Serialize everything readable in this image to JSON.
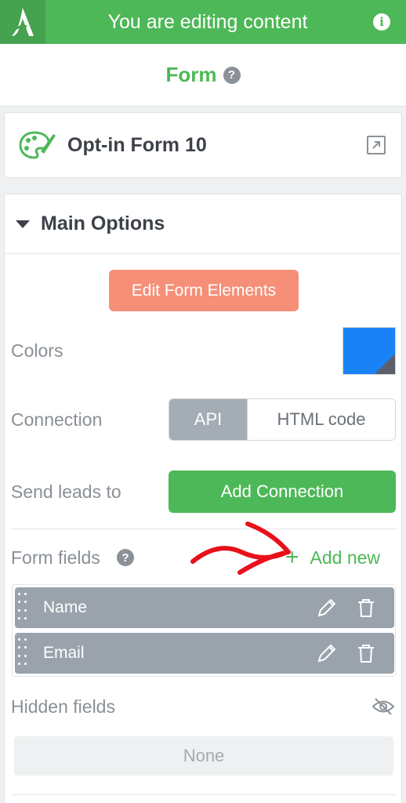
{
  "topbar": {
    "title": "You are editing content",
    "logo_icon": "thrive-logo-icon",
    "info_icon": "info-icon",
    "color": "#4db857"
  },
  "header": {
    "title": "Form",
    "help_icon": "help-icon"
  },
  "form_card": {
    "name": "Opt-in Form 10",
    "icon": "palette-icon",
    "open_icon": "external-link-icon"
  },
  "main_options": {
    "title": "Main Options",
    "edit_button": "Edit Form Elements",
    "colors_label": "Colors",
    "color_value": "#1a82f7",
    "connection_label": "Connection",
    "connection_options": [
      "API",
      "HTML code"
    ],
    "connection_selected": "API",
    "send_leads_label": "Send leads to",
    "add_connection_button": "Add Connection",
    "form_fields_label": "Form fields",
    "add_new_label": "Add new",
    "fields": [
      {
        "name": "Name"
      },
      {
        "name": "Email"
      }
    ],
    "hidden_fields_label": "Hidden fields",
    "hidden_fields_value": "None"
  }
}
